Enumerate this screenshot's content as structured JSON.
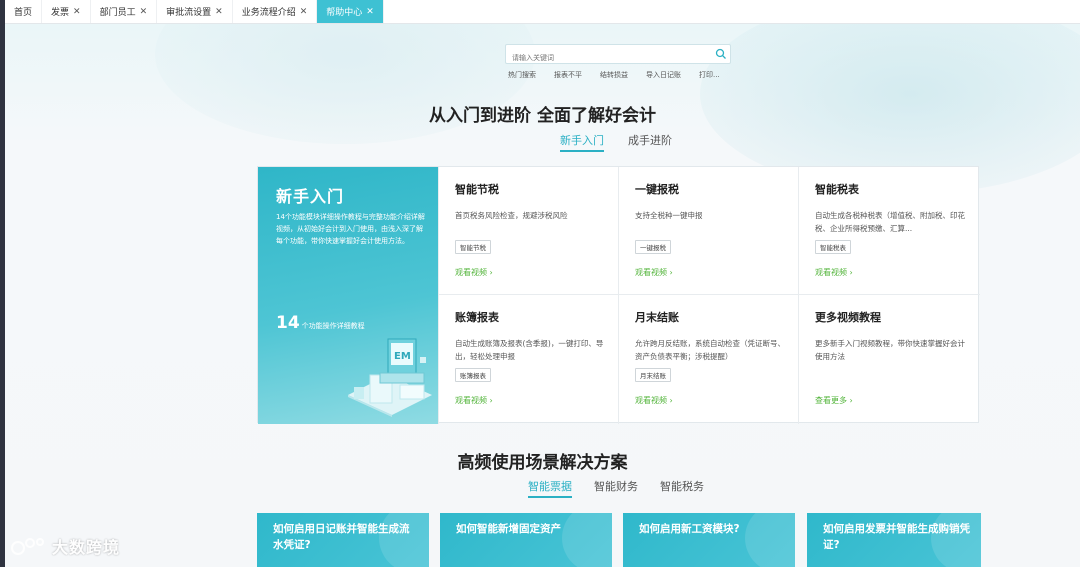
{
  "tabs": [
    {
      "label": "首页",
      "closable": false,
      "active": false
    },
    {
      "label": "发票",
      "closable": true,
      "active": false
    },
    {
      "label": "部门员工",
      "closable": true,
      "active": false
    },
    {
      "label": "审批流设置",
      "closable": true,
      "active": false
    },
    {
      "label": "业务流程介绍",
      "closable": true,
      "active": false
    },
    {
      "label": "帮助中心",
      "closable": true,
      "active": true
    }
  ],
  "search": {
    "placeholder": "请输入关键词"
  },
  "hot_keywords": [
    "热门搜索",
    "报表不平",
    "结转损益",
    "导入日记账",
    "打印..."
  ],
  "section1": {
    "title": "从入门到进阶 全面了解好会计",
    "tabs": [
      {
        "label": "新手入门",
        "active": true
      },
      {
        "label": "成手进阶",
        "active": false
      }
    ]
  },
  "hero": {
    "title": "新手入门",
    "description": "14个功能模块详细操作教程与完整功能介绍详解视频，从初始好会计到入门使用，由浅入深了解每个功能，带你快速掌握好会计使用方法。",
    "count": "14",
    "count_suffix": "个功能操作详细教程"
  },
  "cells": [
    {
      "title": "智能节税",
      "desc": "首页税务风险检查，规避涉税风险",
      "tag": "智能节税",
      "link": "观看视频 ›"
    },
    {
      "title": "一键报税",
      "desc": "支持全税种一键申报",
      "tag": "一键报税",
      "link": "观看视频 ›"
    },
    {
      "title": "智能税表",
      "desc": "自动生成各税种税表（增值税、附加税、印花税、企业所得税预缴、汇算...",
      "tag": "智能税表",
      "link": "观看视频 ›"
    },
    {
      "title": "账簿报表",
      "desc": "自动生成账簿及报表(含季报)，一键打印、导出，轻松处理申报",
      "tag": "账簿报表",
      "link": "观看视频 ›"
    },
    {
      "title": "月末结账",
      "desc": "允许跨月反结账，系统自动检查（凭证断号、资产负债表平衡；涉税提醒）",
      "tag": "月末结账",
      "link": "观看视频 ›"
    },
    {
      "title": "更多视频教程",
      "desc": "更多新手入门视频教程，带你快速掌握好会计使用方法",
      "tag": "",
      "link": "查看更多 ›"
    }
  ],
  "section2": {
    "title": "高频使用场景解决方案",
    "tabs": [
      {
        "label": "智能票据",
        "active": true
      },
      {
        "label": "智能财务",
        "active": false
      },
      {
        "label": "智能税务",
        "active": false
      }
    ]
  },
  "scenario_cards": [
    "如何启用日记账并智能生成流水凭证?",
    "如何智能新增固定资产",
    "如何启用新工资模块?",
    "如何启用发票并智能生成购销凭证?"
  ],
  "watermark": "大数跨境",
  "colors": {
    "accent": "#3ec1d3",
    "link_green": "#52b43a",
    "sidebar_dark": "#2f3340"
  }
}
